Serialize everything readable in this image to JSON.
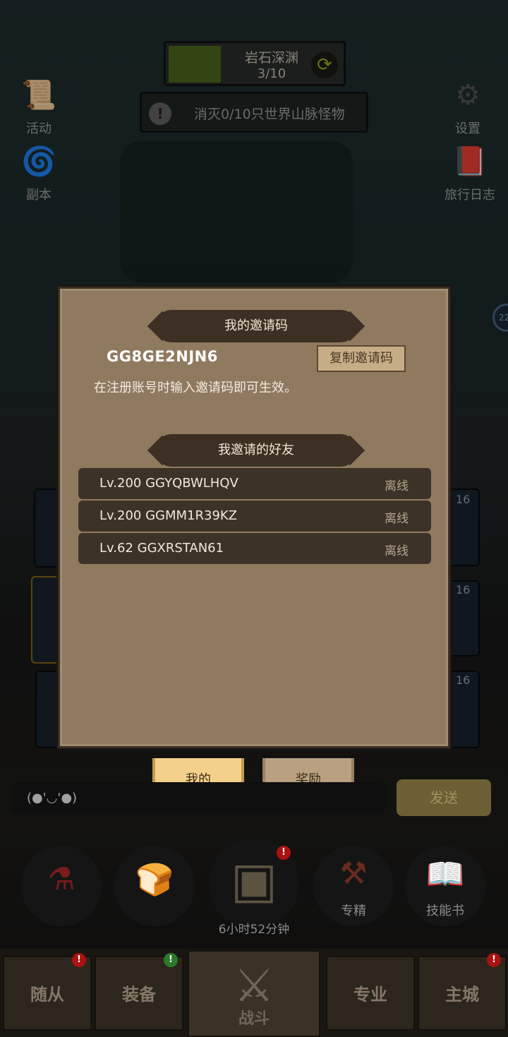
{
  "header": {
    "zone_name": "岩石深渊",
    "zone_progress": "3/10",
    "quest_text": "消灭0/10只世界山脉怪物",
    "progress_fill_fraction": 0.3
  },
  "side_buttons": {
    "activity": "活动",
    "dungeon": "副本",
    "settings": "设置",
    "journal": "旅行日志"
  },
  "modal": {
    "invite_code_title": "我的邀请码",
    "invite_code": "GG8GE2NJN6",
    "copy_button": "复制邀请码",
    "hint": "在注册账号时输入邀请码即可生效。",
    "friends_title": "我邀请的好友",
    "friends": [
      {
        "info": "Lv.200 GGYQBWLHQV",
        "status": "离线"
      },
      {
        "info": "Lv.200 GGMM1R39KZ",
        "status": "离线"
      },
      {
        "info": "Lv.62 GGXRSTAN61",
        "status": "离线"
      }
    ]
  },
  "tabs": {
    "mine": "我的",
    "reward": "奖励"
  },
  "chat": {
    "emoticon": "(●'◡'●)",
    "send": "发送"
  },
  "actions": {
    "timer": "6小时52分钟",
    "refine": "专精",
    "skill_book": "技能书"
  },
  "card_levels": [
    "16",
    "16",
    "16"
  ],
  "nav": {
    "followers": "随从",
    "equipment": "装备",
    "battle": "战斗",
    "profession": "专业",
    "main_city": "主城"
  },
  "side_number": "22"
}
